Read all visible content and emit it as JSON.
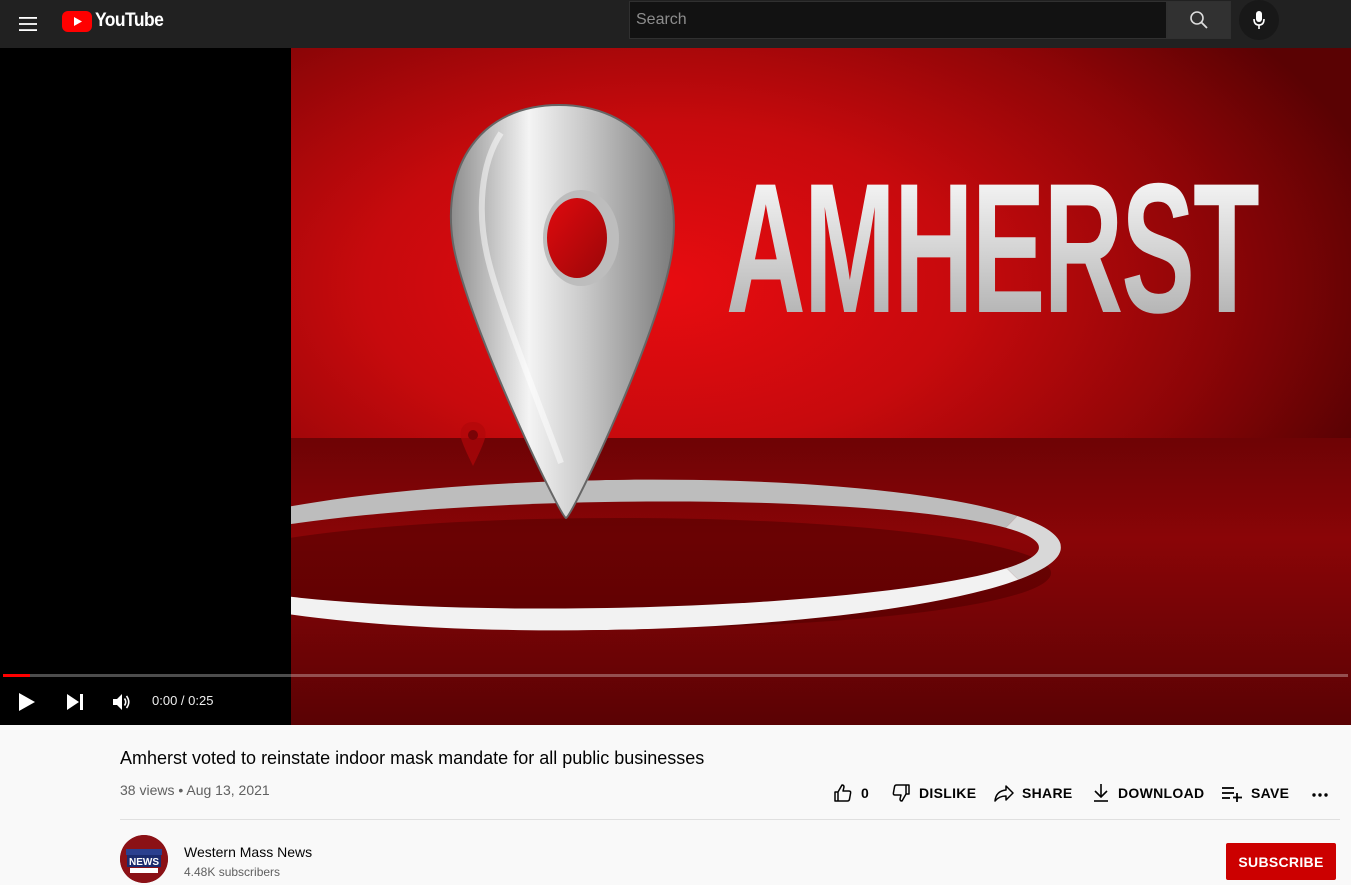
{
  "header": {
    "logo_text": "YouTube",
    "search_placeholder": "Search",
    "icons": [
      "menu-icon",
      "youtube-logo-icon",
      "search-icon",
      "microphone-icon"
    ]
  },
  "player": {
    "frame_text": "AMHERST",
    "time_display": "0:00 / 0:25",
    "progress_fraction": 0.02,
    "icons": [
      "play-icon",
      "next-icon",
      "volume-icon",
      "map-pin-icon"
    ],
    "colors": {
      "progress": "#ff0000",
      "frame_red": "#d10a0d"
    }
  },
  "video": {
    "title": "Amherst voted to reinstate indoor mask mandate for all public businesses",
    "meta": "38 views • Aug 13, 2021",
    "actions": {
      "like_count": "0",
      "dislike_label": "DISLIKE",
      "share_label": "SHARE",
      "download_label": "DOWNLOAD",
      "save_label": "SAVE"
    }
  },
  "channel": {
    "name": "Western Mass News",
    "subscribers": "4.48K subscribers",
    "avatar_text": "NEWS",
    "subscribe_label": "SUBSCRIBE",
    "subscribe_color": "#cc0000"
  }
}
